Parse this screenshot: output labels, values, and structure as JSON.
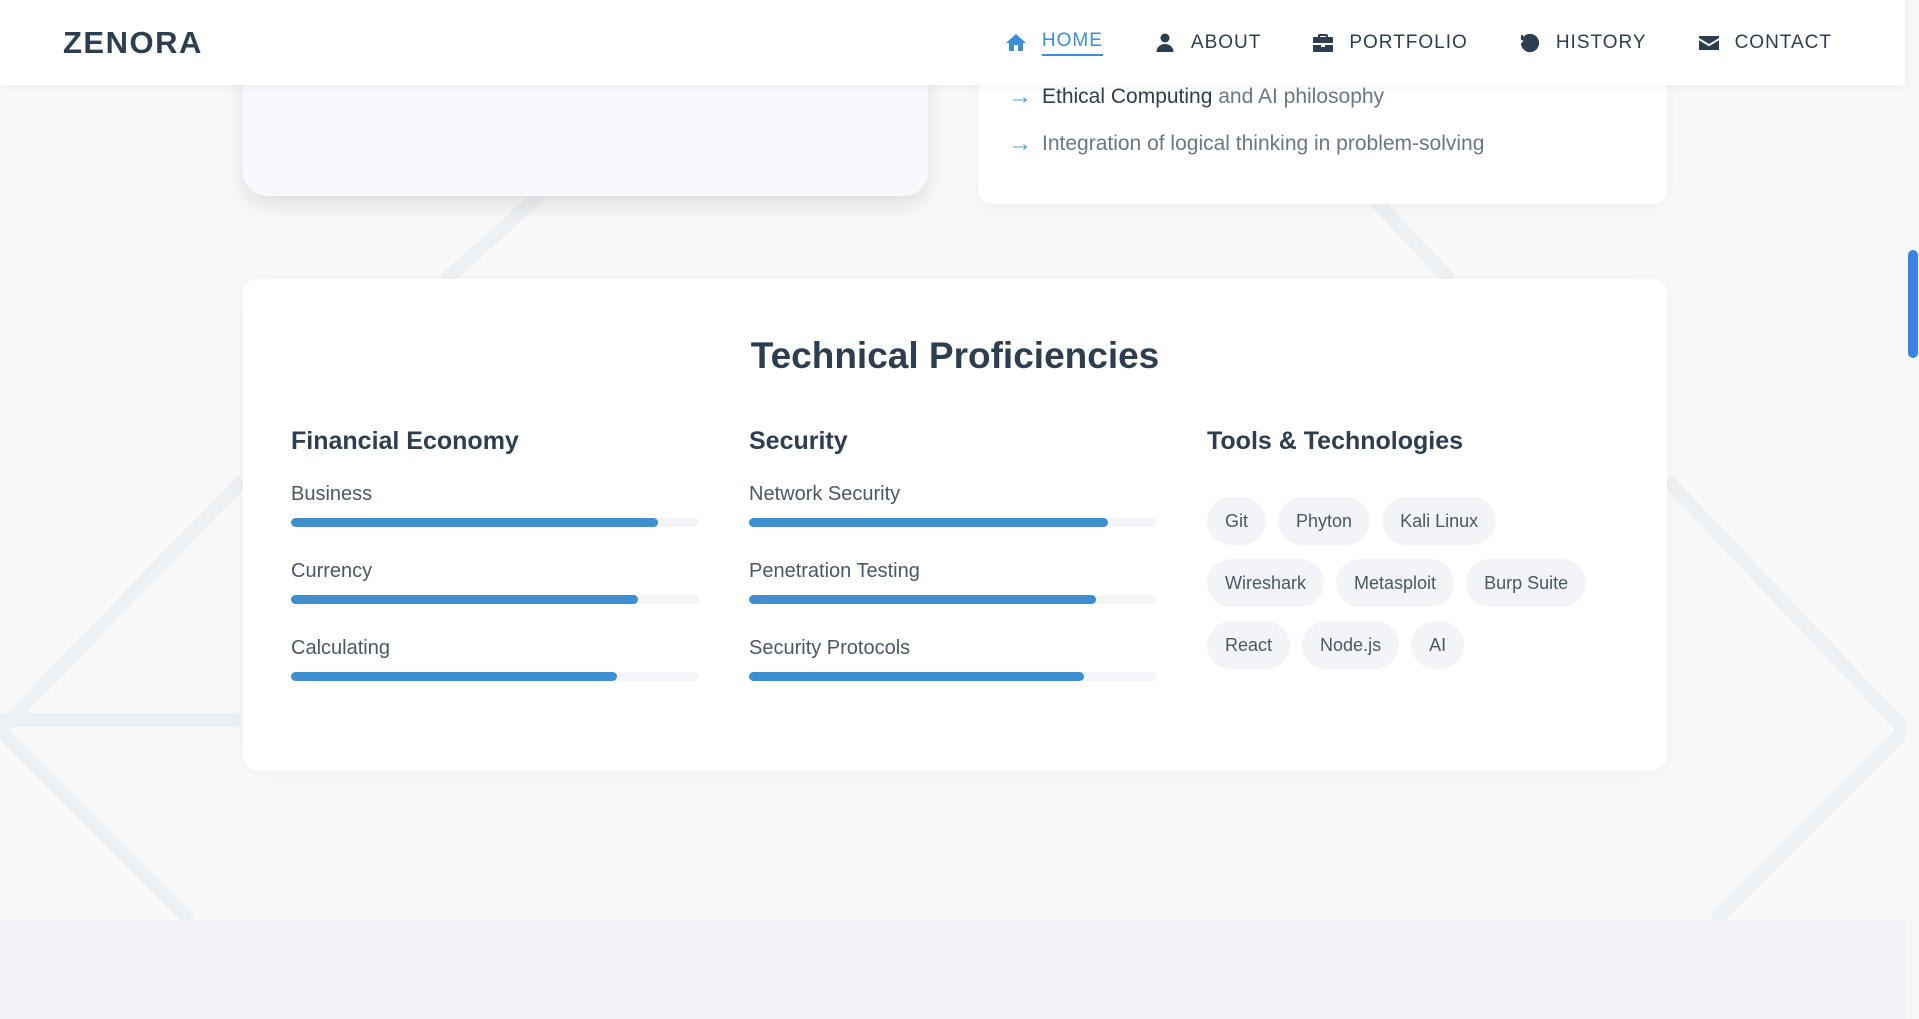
{
  "brand": {
    "logo": "ZENORA",
    "accent": "#3b8fd6",
    "text_dark": "#2c3e50"
  },
  "nav": {
    "items": [
      {
        "label": "HOME",
        "icon": "home-icon",
        "active": true
      },
      {
        "label": "ABOUT",
        "icon": "user-icon",
        "active": false
      },
      {
        "label": "PORTFOLIO",
        "icon": "briefcase-icon",
        "active": false
      },
      {
        "label": "HISTORY",
        "icon": "history-icon",
        "active": false
      },
      {
        "label": "CONTACT",
        "icon": "envelope-icon",
        "active": false
      }
    ]
  },
  "about_points": [
    {
      "bold": "Ethical Computing",
      "rest": " and AI philosophy"
    },
    {
      "bold": "",
      "rest": "Integration of logical thinking in problem-solving"
    }
  ],
  "proficiencies": {
    "title": "Technical Proficiencies",
    "financial": {
      "heading": "Financial Economy",
      "skills": [
        {
          "name": "Business",
          "level": 0.9
        },
        {
          "name": "Currency",
          "level": 0.85
        },
        {
          "name": "Calculating",
          "level": 0.8
        }
      ]
    },
    "security": {
      "heading": "Security",
      "skills": [
        {
          "name": "Network Security",
          "level": 0.88
        },
        {
          "name": "Penetration Testing",
          "level": 0.85
        },
        {
          "name": "Security Protocols",
          "level": 0.82
        }
      ]
    },
    "tools": {
      "heading": "Tools & Technologies",
      "tags": [
        "Git",
        "Phyton",
        "Kali Linux",
        "Wireshark",
        "Metasploit",
        "Burp Suite",
        "React",
        "Node.js",
        "AI"
      ]
    }
  }
}
